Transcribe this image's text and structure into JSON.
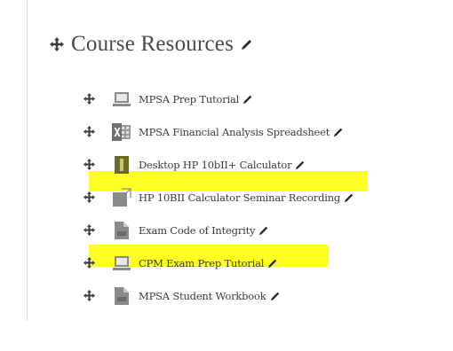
{
  "section": {
    "title": "Course Resources"
  },
  "resources": [
    {
      "label": "MPSA Prep Tutorial",
      "icon": "laptop-icon"
    },
    {
      "label": "MPSA Financial Analysis Spreadsheet",
      "icon": "excel-icon"
    },
    {
      "label": "Desktop HP 10bII+ Calculator",
      "icon": "book-icon",
      "highlighted": true
    },
    {
      "label": "HP 10BII Calculator Seminar Recording",
      "icon": "external-link-icon"
    },
    {
      "label": "Exam Code of Integrity",
      "icon": "pdf-icon",
      "highlighted": true
    },
    {
      "label": "CPM Exam Prep Tutorial",
      "icon": "laptop-icon"
    },
    {
      "label": "MPSA Student Workbook",
      "icon": "pdf-icon"
    }
  ],
  "colors": {
    "highlight": "#ffff00",
    "text": "#3b3b3b",
    "icon_gray": "#8a8a8a"
  }
}
